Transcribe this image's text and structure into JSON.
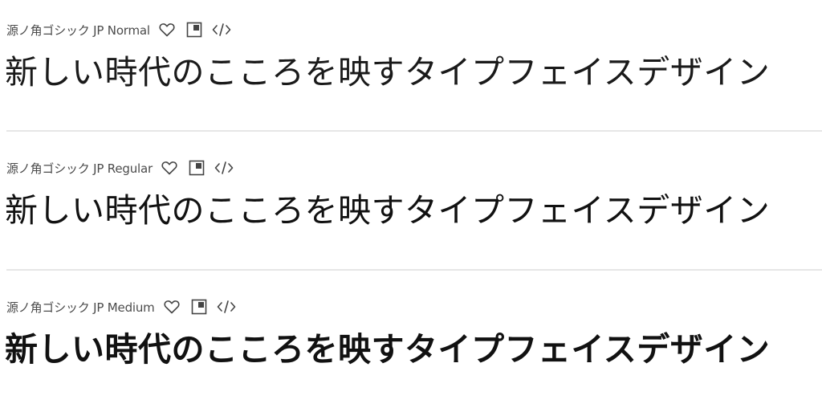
{
  "fonts": [
    {
      "name": "源ノ角ゴシック JP Normal",
      "sample": "新しい時代のこころを映すタイプフェイスデザイン"
    },
    {
      "name": "源ノ角ゴシック JP Regular",
      "sample": "新しい時代のこころを映すタイプフェイスデザイン"
    },
    {
      "name": "源ノ角ゴシック JP Medium",
      "sample": "新しい時代のこころを映すタイプフェイスデザイン"
    }
  ],
  "icons": {
    "favorite": "heart-icon",
    "sample": "layout-icon",
    "embed": "code-icon"
  },
  "colors": {
    "text": "#111111",
    "meta_text": "#4b4b4b",
    "divider": "#e6e6e6",
    "icon": "#444444"
  }
}
